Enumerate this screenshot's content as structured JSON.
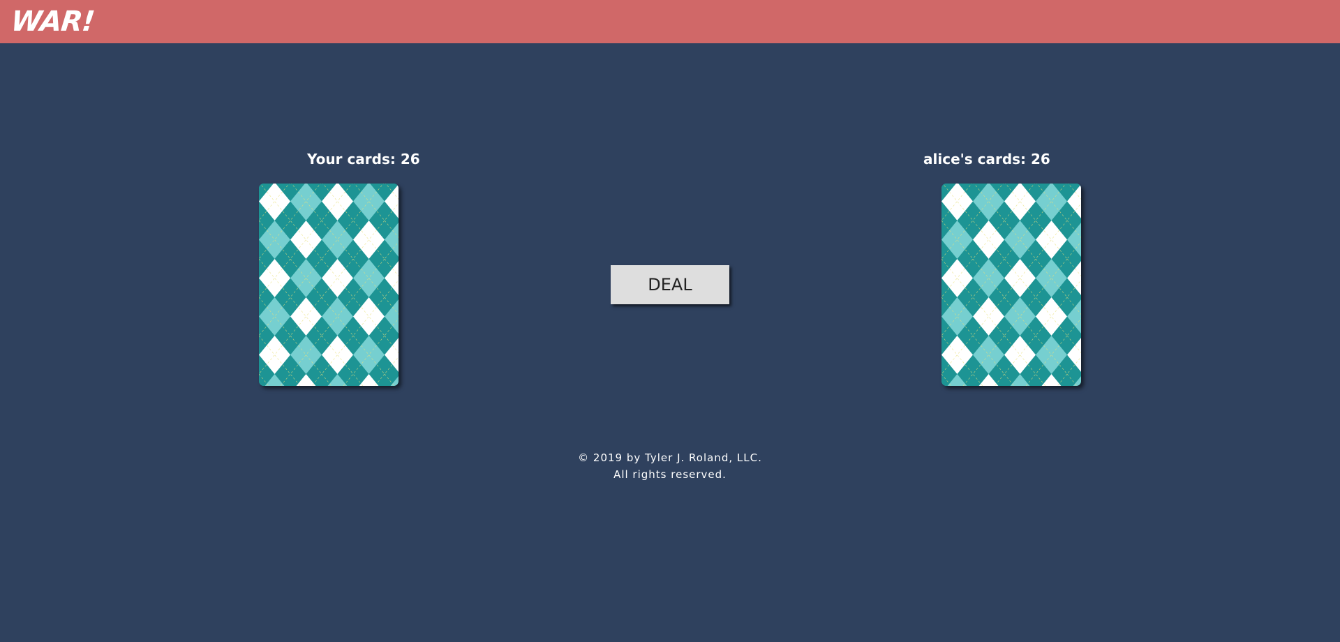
{
  "header": {
    "logo_text": "WAR!",
    "background_color": "#d06868"
  },
  "page": {
    "background_color": "#2f415e"
  },
  "player": {
    "label": "Your cards: 26",
    "card_count": 26,
    "card_back_icon": "argyle-card-back"
  },
  "opponent": {
    "label": "alice's cards: 26",
    "name": "alice",
    "card_count": 26,
    "card_back_icon": "argyle-card-back"
  },
  "actions": {
    "deal_label": "DEAL"
  },
  "card_back_colors": {
    "dark": "#1d9494",
    "light": "#76cfd0",
    "white": "#ffffff",
    "stitch": "#e8e07a"
  },
  "footer": {
    "copyright": "© 2019 by Tyler J. Roland, LLC.",
    "rights": "All rights reserved."
  }
}
